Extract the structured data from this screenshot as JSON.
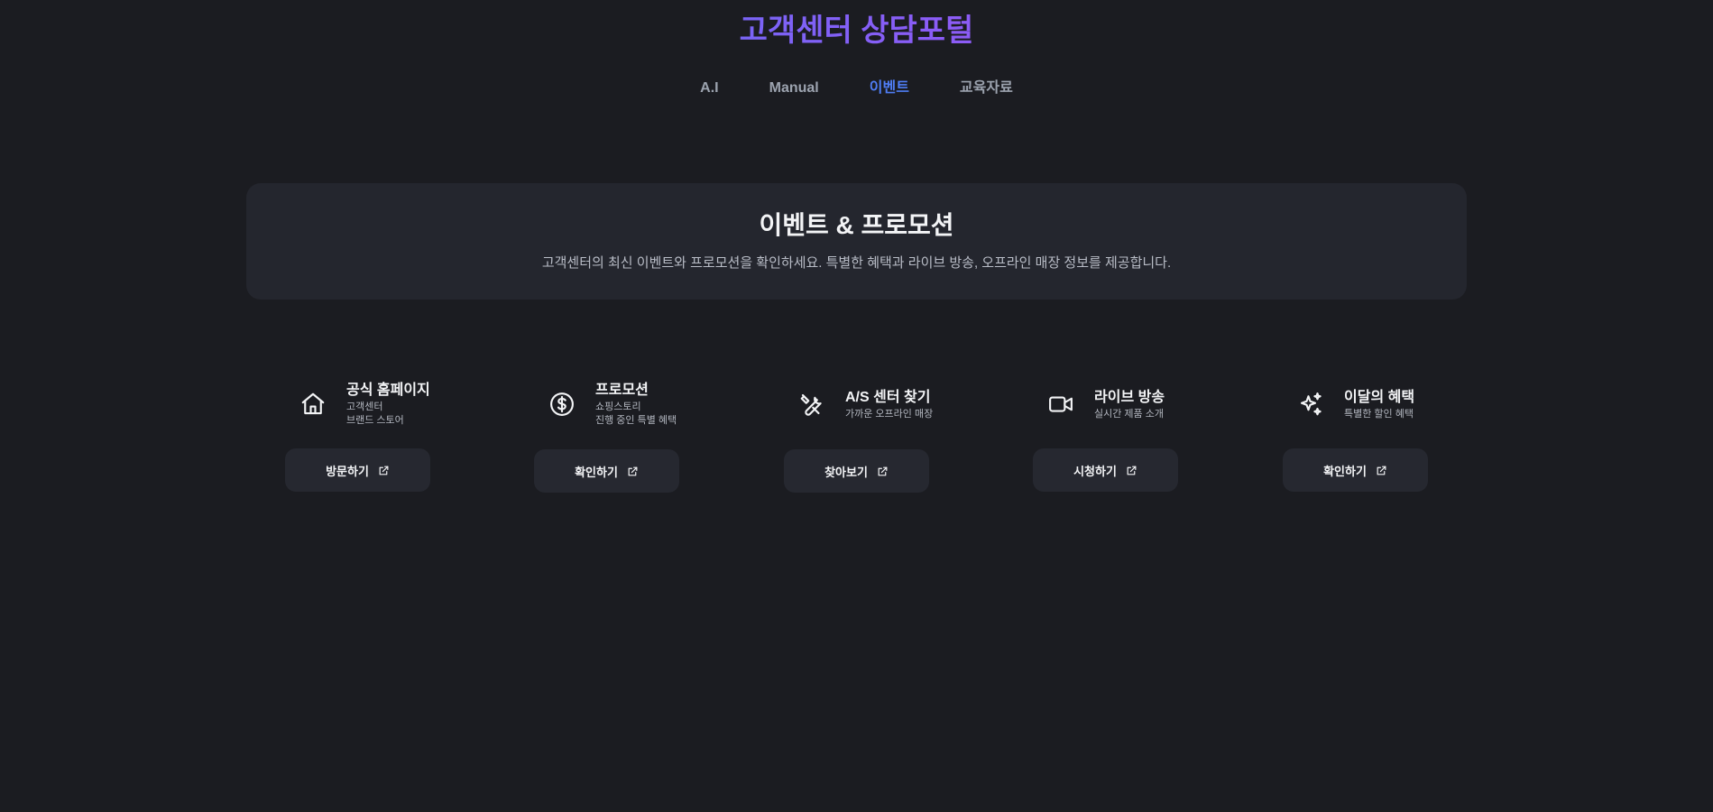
{
  "header": {
    "title": "고객센터 상담포털"
  },
  "nav": {
    "items": [
      {
        "label": "A.I"
      },
      {
        "label": "Manual"
      },
      {
        "label": "이벤트"
      },
      {
        "label": "교육자료"
      }
    ],
    "active": "이벤트",
    "active_color": "#4f7df5"
  },
  "hero": {
    "title": "이벤트 & 프로모션",
    "description": "고객센터의 최신 이벤트와 프로모션을 확인하세요. 특별한 혜택과 라이브 방송, 오프라인 매장 정보를 제공합니다."
  },
  "cards": [
    {
      "icon": "home-icon",
      "title": "공식 홈페이지",
      "subs": [
        "고객센터",
        "브랜드 스토어"
      ],
      "button": "방문하기"
    },
    {
      "icon": "dollar-circle-icon",
      "title": "프로모션",
      "subs": [
        "쇼핑스토리",
        "진행 중인 특별 혜택"
      ],
      "button": "확인하기"
    },
    {
      "icon": "tools-icon",
      "title": "A/S 센터 찾기",
      "subs": [
        "가까운 오프라인 매장"
      ],
      "button": "찾아보기"
    },
    {
      "icon": "video-camera-icon",
      "title": "라이브 방송",
      "subs": [
        "실시간 제품 소개"
      ],
      "button": "시청하기"
    },
    {
      "icon": "sparkles-icon",
      "title": "이달의 혜택",
      "subs": [
        "특별한 할인 혜택"
      ],
      "button": "확인하기"
    }
  ],
  "colors": {
    "background": "#1b1c21",
    "panel": "#24262e",
    "button": "#262830",
    "title_gradient_start": "#3b82f6",
    "title_gradient_end": "#a855f7"
  }
}
